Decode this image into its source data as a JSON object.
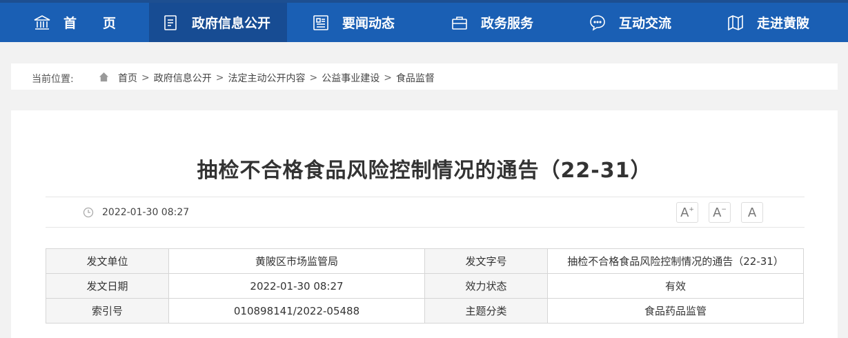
{
  "nav": {
    "items": [
      {
        "label": "首　　页",
        "icon": "bank-icon"
      },
      {
        "label": "政府信息公开",
        "icon": "document-icon"
      },
      {
        "label": "要闻动态",
        "icon": "news-icon"
      },
      {
        "label": "政务服务",
        "icon": "briefcase-icon"
      },
      {
        "label": "互动交流",
        "icon": "chat-icon"
      },
      {
        "label": "走进黄陂",
        "icon": "map-icon"
      }
    ]
  },
  "breadcrumb": {
    "label": "当前位置:",
    "items": [
      "首页",
      "政府信息公开",
      "法定主动公开内容",
      "公益事业建设",
      "食品监督"
    ],
    "separator": ">"
  },
  "article": {
    "title": "抽检不合格食品风险控制情况的通告（22-31）",
    "date": "2022-01-30 08:27",
    "font_buttons": [
      "A",
      "A",
      "A"
    ]
  },
  "info_table": {
    "rows": [
      [
        "发文单位",
        "黄陂区市场监管局",
        "发文字号",
        "抽检不合格食品风险控制情况的通告（22-31）"
      ],
      [
        "发文日期",
        "2022-01-30 08:27",
        "效力状态",
        "有效"
      ],
      [
        "索引号",
        "010898141/2022-05488",
        "主题分类",
        "食品药品监管"
      ]
    ]
  },
  "colors": {
    "nav_bg": "#1a5fb4",
    "nav_active": "#174c93",
    "page_bg": "#f2f2f2"
  }
}
